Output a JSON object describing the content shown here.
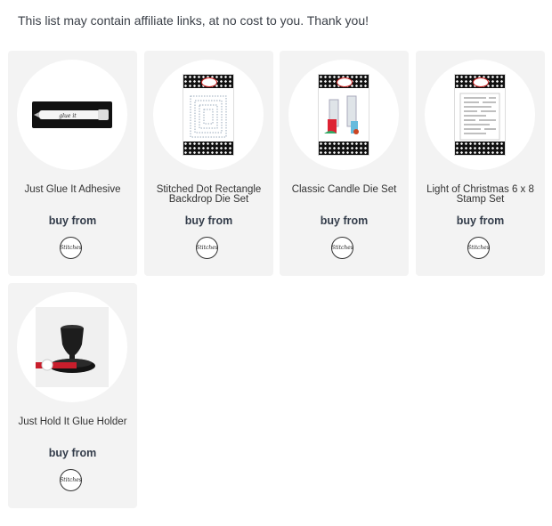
{
  "disclaimer": "This list may contain affiliate links, at no cost to you. Thank you!",
  "buy_label": "buy from",
  "store_logo_text": "Stitches",
  "products": [
    {
      "name": "Just Glue It Adhesive",
      "icon": "glue-pen-icon"
    },
    {
      "name": "Stitched Dot Rectangle Backdrop Die Set",
      "icon": "die-set-package-icon"
    },
    {
      "name": "Classic Candle Die Set",
      "icon": "candle-die-package-icon"
    },
    {
      "name": "Light of Christmas 6 x 8 Stamp Set",
      "icon": "stamp-set-package-icon"
    },
    {
      "name": "Just Hold It Glue Holder",
      "icon": "glue-holder-icon"
    }
  ]
}
